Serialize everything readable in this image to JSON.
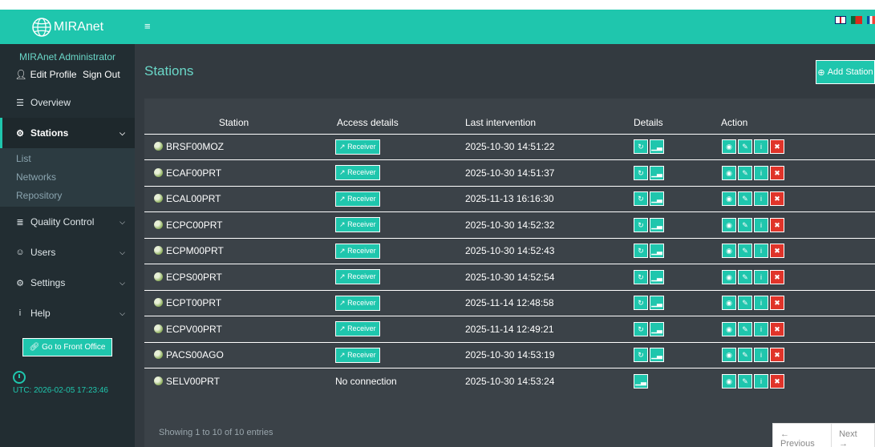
{
  "brand": {
    "name": "MIRAnet",
    "accent": "#1fc6ad"
  },
  "user": {
    "name": "MIRAnet Administrator",
    "edit_profile": "Edit Profile",
    "sign_out": "Sign Out"
  },
  "nav": {
    "overview": "Overview",
    "stations": "Stations",
    "sub": [
      "List",
      "Networks",
      "Repository"
    ],
    "quality_control": "Quality Control",
    "users": "Users",
    "settings": "Settings",
    "help": "Help"
  },
  "front_office": "Go to Front Office",
  "utc": "UTC: 2026-02-05 17:23:46",
  "page": {
    "title": "Stations",
    "add_button": "Add Station"
  },
  "table": {
    "headers": [
      "Station",
      "Access details",
      "Last intervention",
      "Details",
      "Action"
    ],
    "receiver_label": "Receiver",
    "rows": [
      {
        "station": "BRSF00MOZ",
        "access": "receiver",
        "last": "2025-10-30 14:51:22"
      },
      {
        "station": "ECAF00PRT",
        "access": "receiver",
        "last": "2025-10-30 14:51:37"
      },
      {
        "station": "ECAL00PRT",
        "access": "receiver",
        "last": "2025-11-13 16:16:30"
      },
      {
        "station": "ECPC00PRT",
        "access": "receiver",
        "last": "2025-10-30 14:52:32"
      },
      {
        "station": "ECPM00PRT",
        "access": "receiver",
        "last": "2025-10-30 14:52:43"
      },
      {
        "station": "ECPS00PRT",
        "access": "receiver",
        "last": "2025-10-30 14:52:54"
      },
      {
        "station": "ECPT00PRT",
        "access": "receiver",
        "last": "2025-11-14 12:48:58"
      },
      {
        "station": "ECPV00PRT",
        "access": "receiver",
        "last": "2025-11-14 12:49:21"
      },
      {
        "station": "PACS00AGO",
        "access": "receiver",
        "last": "2025-10-30 14:53:19"
      },
      {
        "station": "SELV00PRT",
        "access": "No connection",
        "last": "2025-10-30 14:53:24"
      }
    ]
  },
  "footer": {
    "info": "Showing 1 to 10 of 10 entries",
    "previous": "← Previous",
    "next": "Next →"
  }
}
